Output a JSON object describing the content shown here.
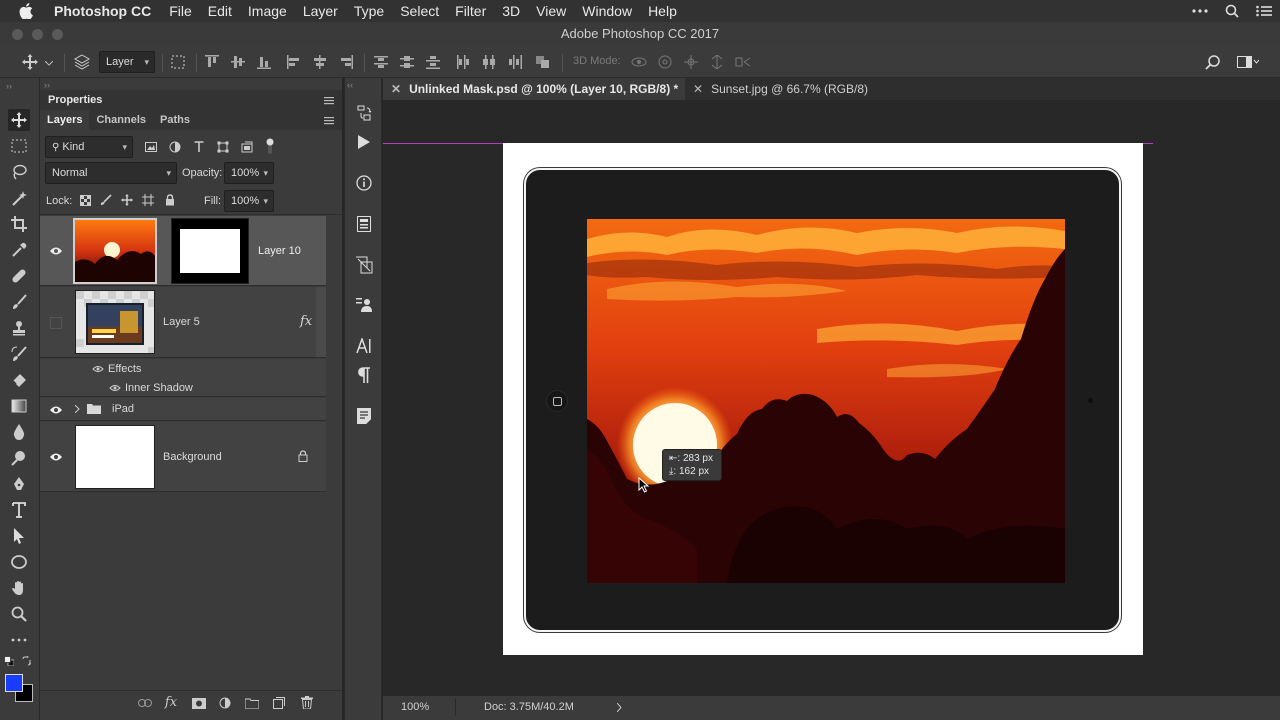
{
  "menubar": {
    "app_name": "Photoshop CC",
    "items": [
      "File",
      "Edit",
      "Image",
      "Layer",
      "Type",
      "Select",
      "Filter",
      "3D",
      "View",
      "Window",
      "Help"
    ]
  },
  "window": {
    "title": "Adobe Photoshop CC 2017"
  },
  "options_bar": {
    "layer_select": "Layer",
    "three_d_mode_label": "3D Mode:"
  },
  "panels": {
    "properties_title": "Properties",
    "tabs": [
      "Layers",
      "Channels",
      "Paths"
    ],
    "filter_kind": "Kind",
    "blend_mode": "Normal",
    "opacity_label": "Opacity:",
    "opacity_value": "100%",
    "lock_label": "Lock:",
    "fill_label": "Fill:",
    "fill_value": "100%",
    "layers": {
      "layer10": "Layer 10",
      "layer5": "Layer 5",
      "fx": "fx",
      "effects": "Effects",
      "inner_shadow": "Inner Shadow",
      "ipad_group": "iPad",
      "background": "Background"
    }
  },
  "doc_tabs": [
    {
      "label": "Unlinked Mask.psd @ 100% (Layer 10, RGB/8) *",
      "active": true
    },
    {
      "label": "Sunset.jpg @ 66.7% (RGB/8)",
      "active": false
    }
  ],
  "tooltip": {
    "line1": ": 283 px",
    "line2": ": 162 px"
  },
  "status": {
    "zoom": "100%",
    "doc": "Doc: 3.75M/40.2M"
  },
  "colors": {
    "foreground": "#1a3cff",
    "background": "#000000",
    "accent_guide": "#b040c0"
  }
}
